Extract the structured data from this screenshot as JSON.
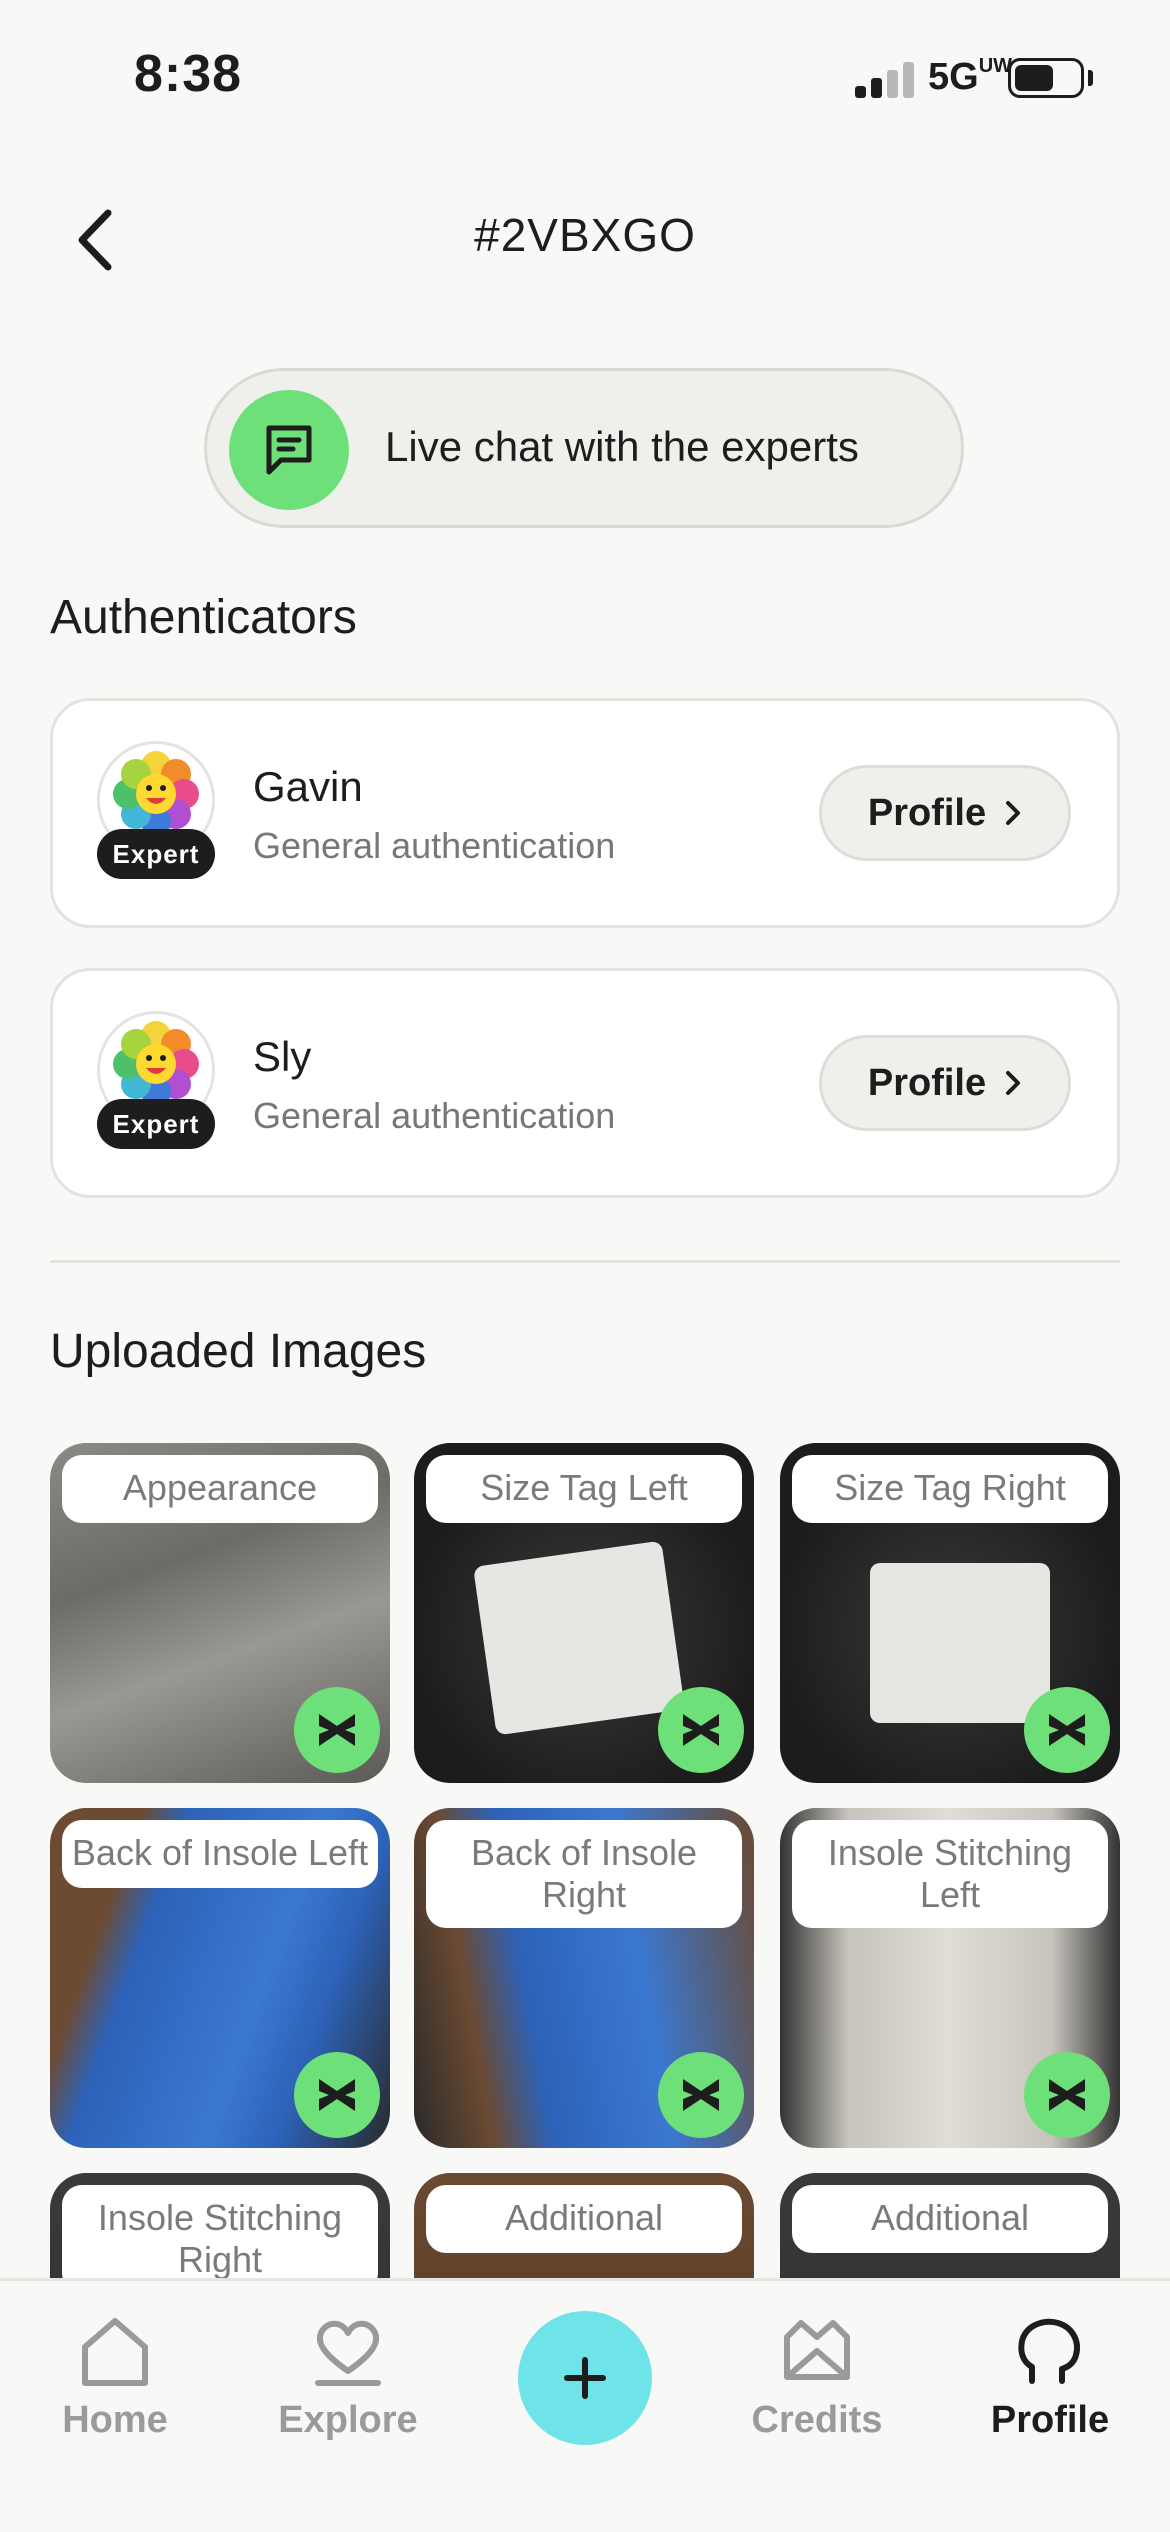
{
  "status_bar": {
    "time": "8:38",
    "network": "5G",
    "network_sub": "UW"
  },
  "header": {
    "title": "#2VBXGO"
  },
  "live_chat": {
    "label": "Live chat with the experts"
  },
  "authenticators": {
    "title": "Authenticators",
    "items": [
      {
        "name": "Gavin",
        "role": "General authentication",
        "badge": "Expert",
        "button": "Profile"
      },
      {
        "name": "Sly",
        "role": "General authentication",
        "badge": "Expert",
        "button": "Profile"
      }
    ]
  },
  "uploaded_images": {
    "title": "Uploaded Images",
    "tiles": [
      {
        "label": "Appearance"
      },
      {
        "label": "Size Tag Left"
      },
      {
        "label": "Size Tag Right"
      },
      {
        "label": "Back of Insole Left"
      },
      {
        "label": "Back of Insole Right"
      },
      {
        "label": "Insole Stitching Left"
      },
      {
        "label": "Insole Stitching Right"
      },
      {
        "label": "Additional"
      },
      {
        "label": "Additional"
      }
    ]
  },
  "nav": {
    "home": "Home",
    "explore": "Explore",
    "credits": "Credits",
    "profile": "Profile"
  },
  "colors": {
    "accent_green": "#6ee07a",
    "accent_cyan": "#6ee3e8"
  }
}
